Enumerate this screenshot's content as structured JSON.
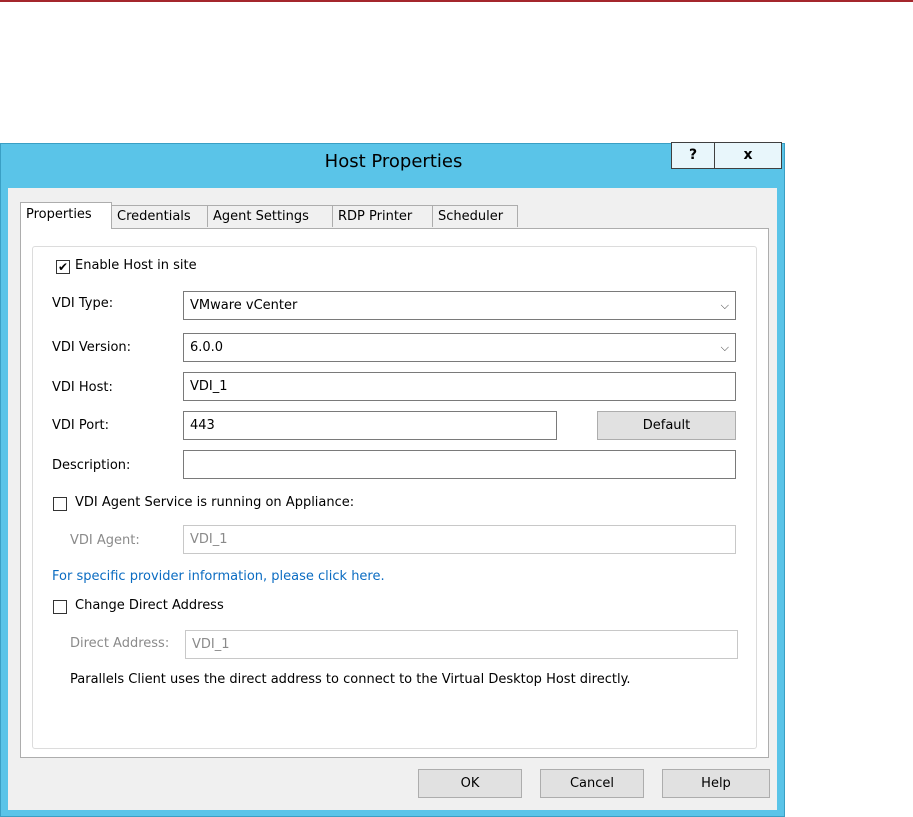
{
  "dialog": {
    "title": "Host Properties",
    "help_button": "?",
    "close_button": "x"
  },
  "tabs": [
    {
      "label": "Properties",
      "active": true
    },
    {
      "label": "Credentials",
      "active": false
    },
    {
      "label": "Agent Settings",
      "active": false
    },
    {
      "label": "RDP Printer",
      "active": false
    },
    {
      "label": "Scheduler",
      "active": false
    }
  ],
  "properties": {
    "enable_host": {
      "label": "Enable Host in site",
      "checked": true,
      "check_glyph": "✔"
    },
    "vdi_type": {
      "label": "VDI Type:",
      "value": "VMware vCenter"
    },
    "vdi_version": {
      "label": "VDI Version:",
      "value": "6.0.0"
    },
    "vdi_host": {
      "label": "VDI Host:",
      "value": "VDI_1"
    },
    "vdi_port": {
      "label": "VDI Port:",
      "value": "443",
      "default_button": "Default"
    },
    "description": {
      "label": "Description:",
      "value": ""
    },
    "agent_on_appliance": {
      "label": "VDI Agent Service is running on Appliance:",
      "checked": false
    },
    "vdi_agent": {
      "label": "VDI Agent:",
      "value": "VDI_1"
    },
    "provider_link": "For specific provider information, please click here.",
    "change_direct": {
      "label": "Change Direct Address",
      "checked": false
    },
    "direct_address": {
      "label": "Direct Address:",
      "value": "VDI_1"
    },
    "direct_note": "Parallels Client uses the direct address to connect to the Virtual Desktop Host directly."
  },
  "footer": {
    "ok": "OK",
    "cancel": "Cancel",
    "help": "Help"
  },
  "colors": {
    "title_bar": "#5ac4e8",
    "link": "#0b6cc2",
    "top_line": "#a4262c"
  }
}
